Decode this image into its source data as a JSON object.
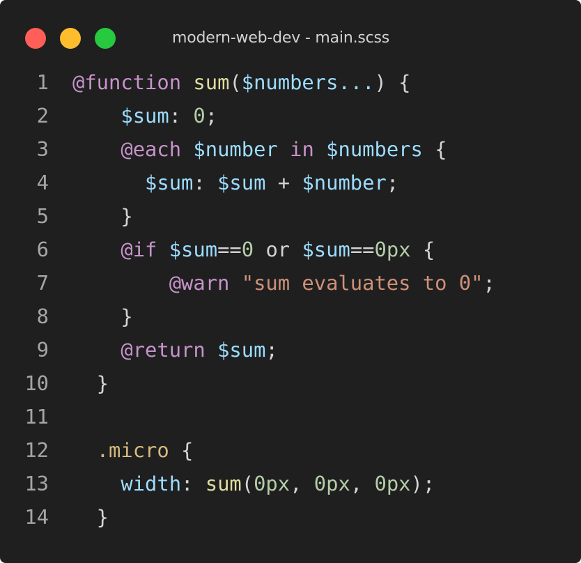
{
  "window": {
    "title": "modern-web-dev - main.scss",
    "controls": [
      {
        "name": "close-button",
        "color": "#ff5f56"
      },
      {
        "name": "minimize-button",
        "color": "#ffbd2e"
      },
      {
        "name": "maximize-button",
        "color": "#27c93f"
      }
    ]
  },
  "editor": {
    "language": "scss",
    "colors": {
      "background": "#1f1f20",
      "line_number": "#a6a6a6",
      "keyword": "#c792c9",
      "function": "#e0dd9e",
      "variable": "#9cdcfe",
      "number": "#b5cea8",
      "string": "#ce9178",
      "selector": "#d7ba7d",
      "plain": "#d4d4d4"
    },
    "lines": [
      {
        "number": "1",
        "tokens": [
          {
            "text": "@function",
            "type": "keyword"
          },
          {
            "text": " ",
            "type": "plain"
          },
          {
            "text": "sum",
            "type": "function"
          },
          {
            "text": "(",
            "type": "plain"
          },
          {
            "text": "$numbers",
            "type": "variable"
          },
          {
            "text": "...",
            "type": "variable"
          },
          {
            "text": ") {",
            "type": "plain"
          }
        ]
      },
      {
        "number": "2",
        "tokens": [
          {
            "text": "    ",
            "type": "plain"
          },
          {
            "text": "$sum",
            "type": "variable"
          },
          {
            "text": ": ",
            "type": "plain"
          },
          {
            "text": "0",
            "type": "number"
          },
          {
            "text": ";",
            "type": "plain"
          }
        ]
      },
      {
        "number": "3",
        "tokens": [
          {
            "text": "    ",
            "type": "plain"
          },
          {
            "text": "@each",
            "type": "keyword"
          },
          {
            "text": " ",
            "type": "plain"
          },
          {
            "text": "$number",
            "type": "variable"
          },
          {
            "text": " ",
            "type": "plain"
          },
          {
            "text": "in",
            "type": "keyword"
          },
          {
            "text": " ",
            "type": "plain"
          },
          {
            "text": "$numbers",
            "type": "variable"
          },
          {
            "text": " {",
            "type": "plain"
          }
        ]
      },
      {
        "number": "4",
        "tokens": [
          {
            "text": "      ",
            "type": "plain"
          },
          {
            "text": "$sum",
            "type": "variable"
          },
          {
            "text": ": ",
            "type": "plain"
          },
          {
            "text": "$sum",
            "type": "variable"
          },
          {
            "text": " + ",
            "type": "plain"
          },
          {
            "text": "$number",
            "type": "variable"
          },
          {
            "text": ";",
            "type": "plain"
          }
        ]
      },
      {
        "number": "5",
        "tokens": [
          {
            "text": "    }",
            "type": "plain"
          }
        ]
      },
      {
        "number": "6",
        "tokens": [
          {
            "text": "    ",
            "type": "plain"
          },
          {
            "text": "@if",
            "type": "keyword"
          },
          {
            "text": " ",
            "type": "plain"
          },
          {
            "text": "$sum",
            "type": "variable"
          },
          {
            "text": "==",
            "type": "plain"
          },
          {
            "text": "0",
            "type": "number"
          },
          {
            "text": " or ",
            "type": "plain"
          },
          {
            "text": "$sum",
            "type": "variable"
          },
          {
            "text": "==",
            "type": "plain"
          },
          {
            "text": "0px",
            "type": "number"
          },
          {
            "text": " {",
            "type": "plain"
          }
        ]
      },
      {
        "number": "7",
        "tokens": [
          {
            "text": "        ",
            "type": "plain"
          },
          {
            "text": "@warn",
            "type": "keyword"
          },
          {
            "text": " ",
            "type": "plain"
          },
          {
            "text": "\"sum evaluates to 0\"",
            "type": "string"
          },
          {
            "text": ";",
            "type": "plain"
          }
        ]
      },
      {
        "number": "8",
        "tokens": [
          {
            "text": "    }",
            "type": "plain"
          }
        ]
      },
      {
        "number": "9",
        "tokens": [
          {
            "text": "    ",
            "type": "plain"
          },
          {
            "text": "@return",
            "type": "keyword"
          },
          {
            "text": " ",
            "type": "plain"
          },
          {
            "text": "$sum",
            "type": "variable"
          },
          {
            "text": ";",
            "type": "plain"
          }
        ]
      },
      {
        "number": "10",
        "tokens": [
          {
            "text": "  }",
            "type": "plain"
          }
        ]
      },
      {
        "number": "11",
        "tokens": []
      },
      {
        "number": "12",
        "tokens": [
          {
            "text": "  ",
            "type": "plain"
          },
          {
            "text": ".micro",
            "type": "selector"
          },
          {
            "text": " {",
            "type": "plain"
          }
        ]
      },
      {
        "number": "13",
        "tokens": [
          {
            "text": "    ",
            "type": "plain"
          },
          {
            "text": "width",
            "type": "variable"
          },
          {
            "text": ": ",
            "type": "plain"
          },
          {
            "text": "sum",
            "type": "function"
          },
          {
            "text": "(",
            "type": "plain"
          },
          {
            "text": "0px",
            "type": "number"
          },
          {
            "text": ", ",
            "type": "plain"
          },
          {
            "text": "0px",
            "type": "number"
          },
          {
            "text": ", ",
            "type": "plain"
          },
          {
            "text": "0px",
            "type": "number"
          },
          {
            "text": ");",
            "type": "plain"
          }
        ]
      },
      {
        "number": "14",
        "tokens": [
          {
            "text": "  }",
            "type": "plain"
          }
        ]
      }
    ]
  }
}
